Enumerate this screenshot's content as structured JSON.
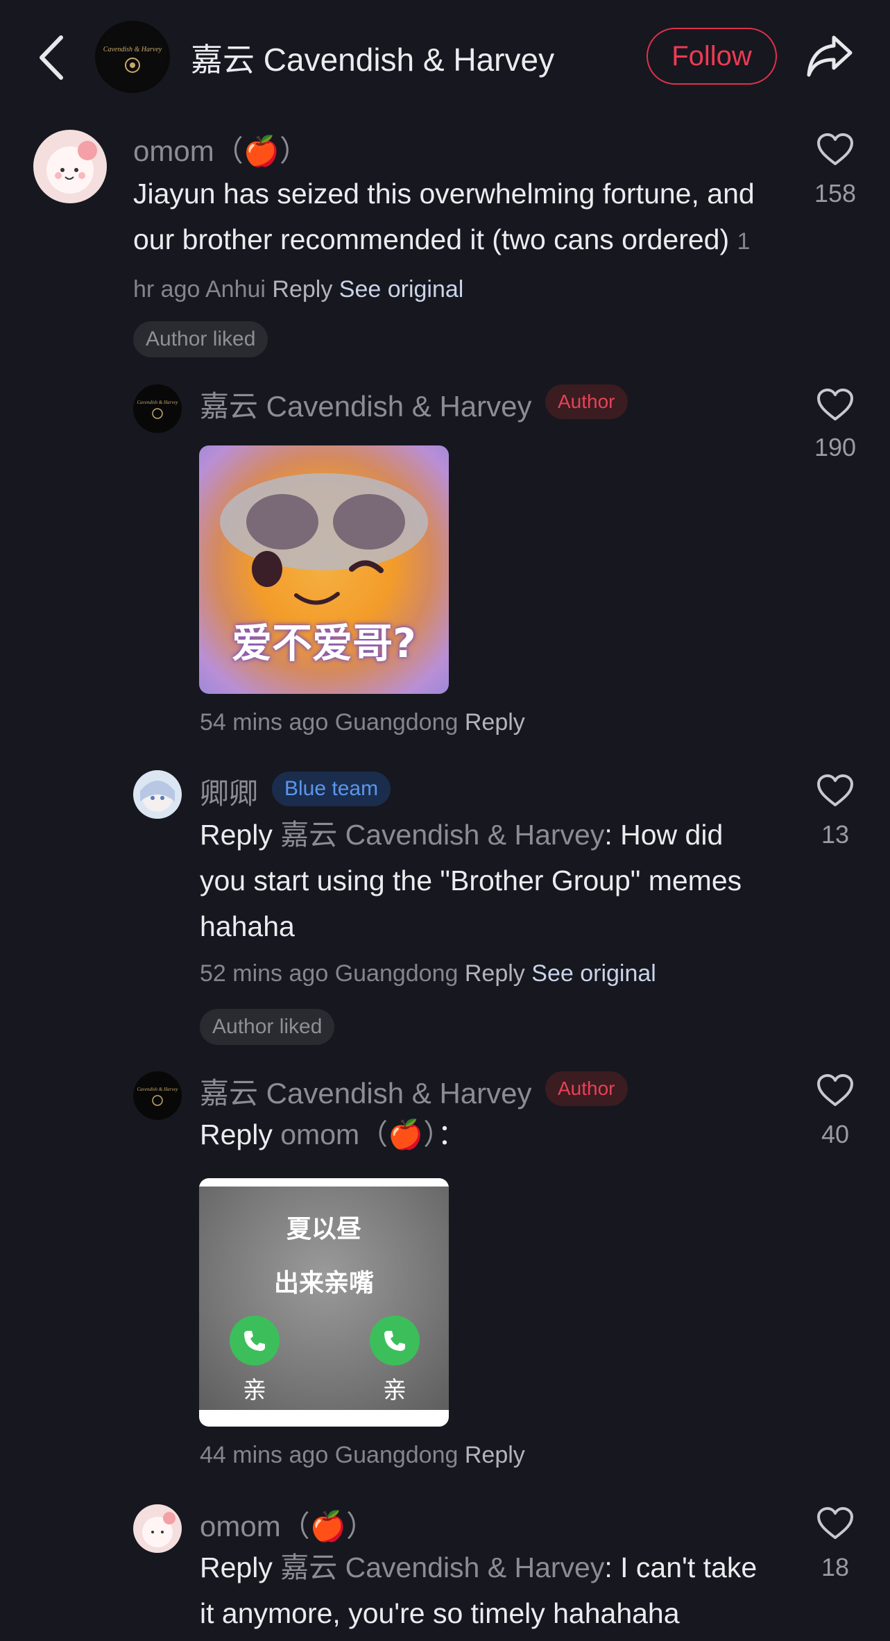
{
  "header": {
    "title": "嘉云 Cavendish & Harvey",
    "follow_label": "Follow"
  },
  "comments": [
    {
      "name": "omom（🍎）",
      "text": "Jiayun has seized this overwhelming fortune, and our brother recommended it (two cans ordered)",
      "time": "1 hr ago",
      "location": "Anhui",
      "reply_label": "Reply",
      "see_original": "See original",
      "author_liked": "Author liked",
      "likes": "158"
    },
    {
      "name": "嘉云 Cavendish & Harvey",
      "badge": "Author",
      "sticker_caption": "爱不爱哥?",
      "time": "54 mins ago",
      "location": "Guangdong",
      "reply_label": "Reply",
      "likes": "190"
    },
    {
      "name": "卿卿",
      "badge": "Blue team",
      "reply_prefix": "Reply",
      "reply_to": "嘉云 Cavendish & Harvey",
      "text": ": How did you start using the \"Brother Group\" memes hahaha",
      "time": "52 mins ago",
      "location": "Guangdong",
      "reply_label": "Reply",
      "see_original": "See original",
      "author_liked": "Author liked",
      "likes": "13"
    },
    {
      "name": "嘉云 Cavendish & Harvey",
      "badge": "Author",
      "reply_prefix": "Reply",
      "reply_to": "omom（🍎）",
      "text": "：",
      "sticker_line1": "夏以昼",
      "sticker_line2": "出来亲嘴",
      "sticker_btn_left": "亲",
      "sticker_btn_right": "亲",
      "time": "44 mins ago",
      "location": "Guangdong",
      "reply_label": "Reply",
      "likes": "40"
    },
    {
      "name": "omom（🍎）",
      "reply_prefix": "Reply",
      "reply_to": "嘉云 Cavendish & Harvey",
      "text": ": I can't take it anymore, you're so timely hahahaha",
      "likes": "18"
    }
  ]
}
